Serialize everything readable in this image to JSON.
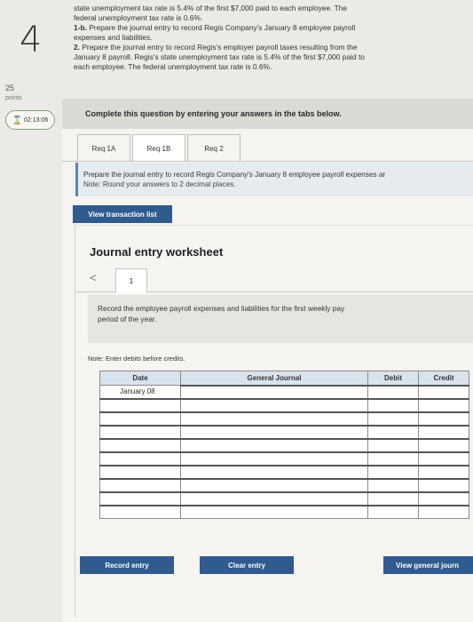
{
  "question": {
    "number": "4",
    "points_value": "25",
    "points_label": "points",
    "timer": "02:13:06",
    "text_line1": "state unemployment tax rate is 5.4% of the first $7,000 paid to each employee. The",
    "text_line2": "federal unemployment tax rate is 0.6%.",
    "part_1b_label": "1-b.",
    "part_1b_text": " Prepare the journal entry to record Regis Company's January 8 employee payroll",
    "part_1b_text2": "expenses and liabilities.",
    "part_2_label": "2.",
    "part_2_text": " Prepare the journal entry to record Regis's employer payroll taxes resulting from the",
    "part_2_text2": "January 8 payroll. Regis's state unemployment tax rate is 5.4% of the first $7,000 paid to",
    "part_2_text3": "each employee. The federal unemployment tax rate is 0.6%."
  },
  "instructions": "Complete this question by entering your answers in the tabs below.",
  "tabs": [
    {
      "label": "Req 1A"
    },
    {
      "label": "Req 1B"
    },
    {
      "label": "Req 2"
    }
  ],
  "requirement": {
    "text": "Prepare the journal entry to record Regis Company's January 8 employee payroll expenses ar",
    "note": "Note: Round your answers to 2 decimal places."
  },
  "buttons": {
    "view_transactions": "View transaction list",
    "record_entry": "Record entry",
    "clear_entry": "Clear entry",
    "view_general": "View general journ"
  },
  "worksheet": {
    "title": "Journal entry worksheet",
    "nav_prev": "<",
    "entry_number": "1",
    "record_text_1": "Record the employee payroll expenses and liabilities for the first weekly pay",
    "record_text_2": "period of the year.",
    "note_debits": "Note: Enter debits before credits.",
    "columns": {
      "date": "Date",
      "general_journal": "General Journal",
      "debit": "Debit",
      "credit": "Credit"
    },
    "first_date": "January 08"
  }
}
